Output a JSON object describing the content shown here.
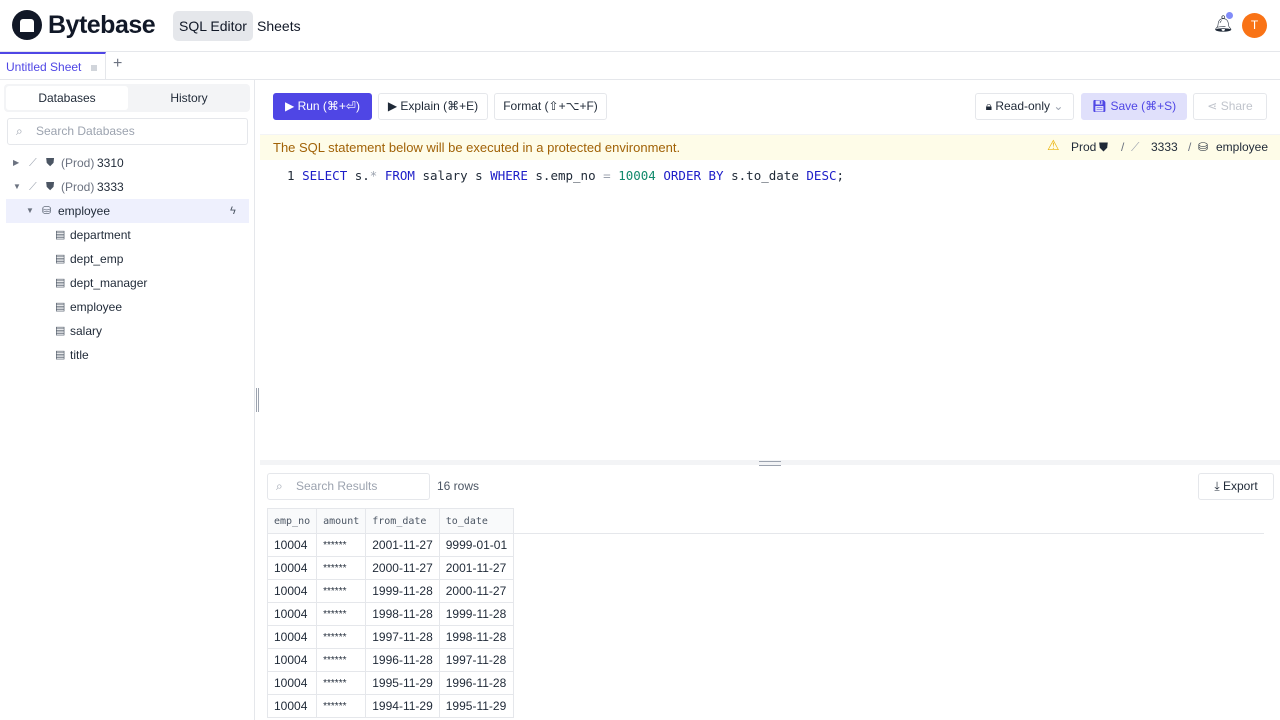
{
  "header": {
    "brand": "Bytebase",
    "nav": [
      "SQL Editor",
      "Sheets"
    ],
    "avatar": "T"
  },
  "tabs": {
    "sheet": "Untitled Sheet",
    "add": "+"
  },
  "sidebar": {
    "tabs": [
      "Databases",
      "History"
    ],
    "search_placeholder": "Search Databases",
    "instances": [
      {
        "env": "(Prod)",
        "name": "3310",
        "expanded": false
      },
      {
        "env": "(Prod)",
        "name": "3333",
        "expanded": true
      }
    ],
    "database": "employee",
    "tables": [
      "department",
      "dept_emp",
      "dept_manager",
      "employee",
      "salary",
      "title"
    ]
  },
  "toolbar": {
    "run": "Run (⌘+⏎)",
    "explain": "Explain (⌘+E)",
    "format": "Format (⇧+⌥+F)",
    "mode": "Read-only",
    "save": "Save (⌘+S)",
    "share": "Share"
  },
  "banner": {
    "message": "The SQL statement below will be executed in a protected environment.",
    "env": "Prod",
    "instance": "3333",
    "database": "employee"
  },
  "editor": {
    "line": "1"
  },
  "results": {
    "search_placeholder": "Search Results",
    "count": "16 rows",
    "export": "Export",
    "columns": [
      "emp_no",
      "amount",
      "from_date",
      "to_date"
    ],
    "rows": [
      [
        "10004",
        "******",
        "2001-11-27",
        "9999-01-01"
      ],
      [
        "10004",
        "******",
        "2000-11-27",
        "2001-11-27"
      ],
      [
        "10004",
        "******",
        "1999-11-28",
        "2000-11-27"
      ],
      [
        "10004",
        "******",
        "1998-11-28",
        "1999-11-28"
      ],
      [
        "10004",
        "******",
        "1997-11-28",
        "1998-11-28"
      ],
      [
        "10004",
        "******",
        "1996-11-28",
        "1997-11-28"
      ],
      [
        "10004",
        "******",
        "1995-11-29",
        "1996-11-28"
      ],
      [
        "10004",
        "******",
        "1994-11-29",
        "1995-11-29"
      ]
    ]
  },
  "colors": {
    "accent": "#4f46e5",
    "warning": "#a16207",
    "avatar": "#f97316"
  }
}
